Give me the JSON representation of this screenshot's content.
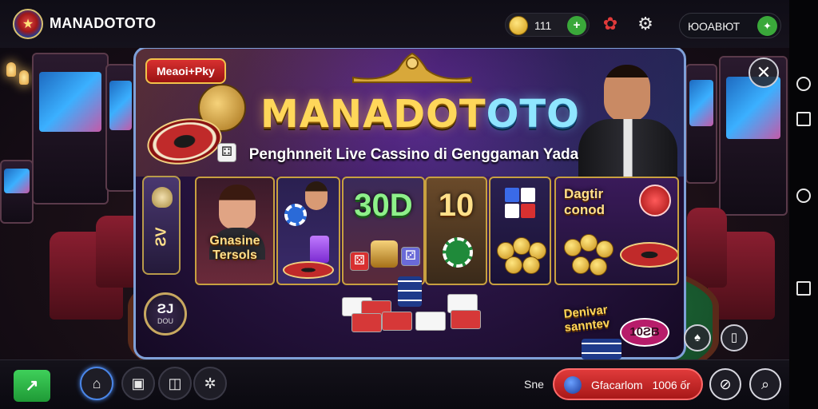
{
  "header": {
    "brand": "MANADOTOTO",
    "balance": "111",
    "account": "ЮОАВЮТ"
  },
  "banner": {
    "badge": "Meaoi+Pky",
    "title_main": "MANADOT",
    "title_tail": "OTO",
    "subtitle": "Penghnneit Live Cassino di Genggaman Yada"
  },
  "cards": {
    "card1_label": "Gnasine Tersols",
    "card2_big": "30D",
    "card3_big": "10",
    "card4_label": "Dagtir conod"
  },
  "side": {
    "tile_text": "ƧV",
    "badge_main": "ƧJ",
    "badge_sub": "DOU"
  },
  "promo": {
    "text": "Denivar sanntev",
    "chip": "10ƧB"
  },
  "bottom": {
    "label": "Sne",
    "pill_text": "Gfacarlom",
    "pill_value": "1006 ốr"
  },
  "colors": {
    "accent_gold": "#ffd75a",
    "accent_green": "#3aa83a",
    "accent_red": "#d63030",
    "frame_blue": "#7fa0d8"
  },
  "icons": {
    "coin": "coin-icon",
    "add": "plus-icon",
    "mascot": "lion-icon",
    "settings": "gear-icon",
    "close": "close-icon",
    "search": "search-icon"
  }
}
